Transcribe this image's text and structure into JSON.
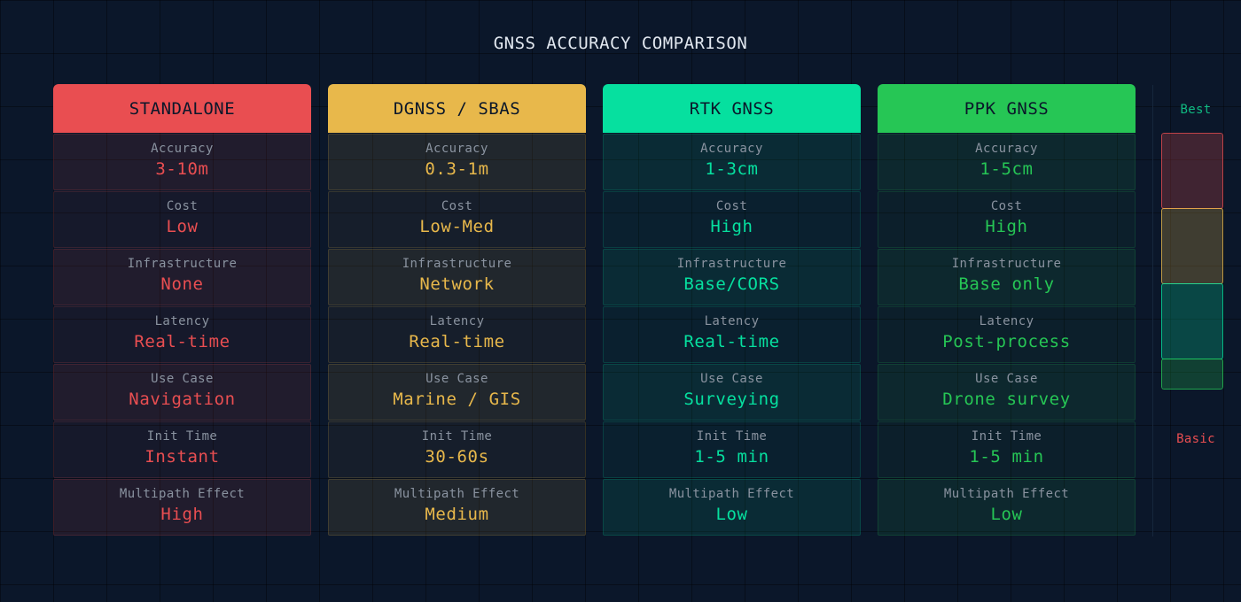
{
  "title": "GNSS ACCURACY COMPARISON",
  "columns": [
    {
      "name": "STANDALONE",
      "accent": "#e94e51",
      "rows": [
        {
          "label": "Accuracy",
          "value": "3-10m"
        },
        {
          "label": "Cost",
          "value": "Low"
        },
        {
          "label": "Infrastructure",
          "value": "None"
        },
        {
          "label": "Latency",
          "value": "Real-time"
        },
        {
          "label": "Use Case",
          "value": "Navigation"
        },
        {
          "label": "Init Time",
          "value": "Instant"
        },
        {
          "label": "Multipath Effect",
          "value": "High"
        }
      ]
    },
    {
      "name": "DGNSS / SBAS",
      "accent": "#e8b84b",
      "rows": [
        {
          "label": "Accuracy",
          "value": "0.3-1m"
        },
        {
          "label": "Cost",
          "value": "Low-Med"
        },
        {
          "label": "Infrastructure",
          "value": "Network"
        },
        {
          "label": "Latency",
          "value": "Real-time"
        },
        {
          "label": "Use Case",
          "value": "Marine / GIS"
        },
        {
          "label": "Init Time",
          "value": "30-60s"
        },
        {
          "label": "Multipath Effect",
          "value": "Medium"
        }
      ]
    },
    {
      "name": "RTK GNSS",
      "accent": "#06e09f",
      "rows": [
        {
          "label": "Accuracy",
          "value": "1-3cm"
        },
        {
          "label": "Cost",
          "value": "High"
        },
        {
          "label": "Infrastructure",
          "value": "Base/CORS"
        },
        {
          "label": "Latency",
          "value": "Real-time"
        },
        {
          "label": "Use Case",
          "value": "Surveying"
        },
        {
          "label": "Init Time",
          "value": "1-5 min"
        },
        {
          "label": "Multipath Effect",
          "value": "Low"
        }
      ]
    },
    {
      "name": "PPK GNSS",
      "accent": "#26c655",
      "rows": [
        {
          "label": "Accuracy",
          "value": "1-5cm"
        },
        {
          "label": "Cost",
          "value": "High"
        },
        {
          "label": "Infrastructure",
          "value": "Base only"
        },
        {
          "label": "Latency",
          "value": "Post-process"
        },
        {
          "label": "Use Case",
          "value": "Drone survey"
        },
        {
          "label": "Init Time",
          "value": "1-5 min"
        },
        {
          "label": "Multipath Effect",
          "value": "Low"
        }
      ]
    }
  ],
  "scale": {
    "top_label": "Best",
    "bottom_label": "Basic",
    "top_color": "#10b981",
    "bottom_color": "#e94e51"
  }
}
